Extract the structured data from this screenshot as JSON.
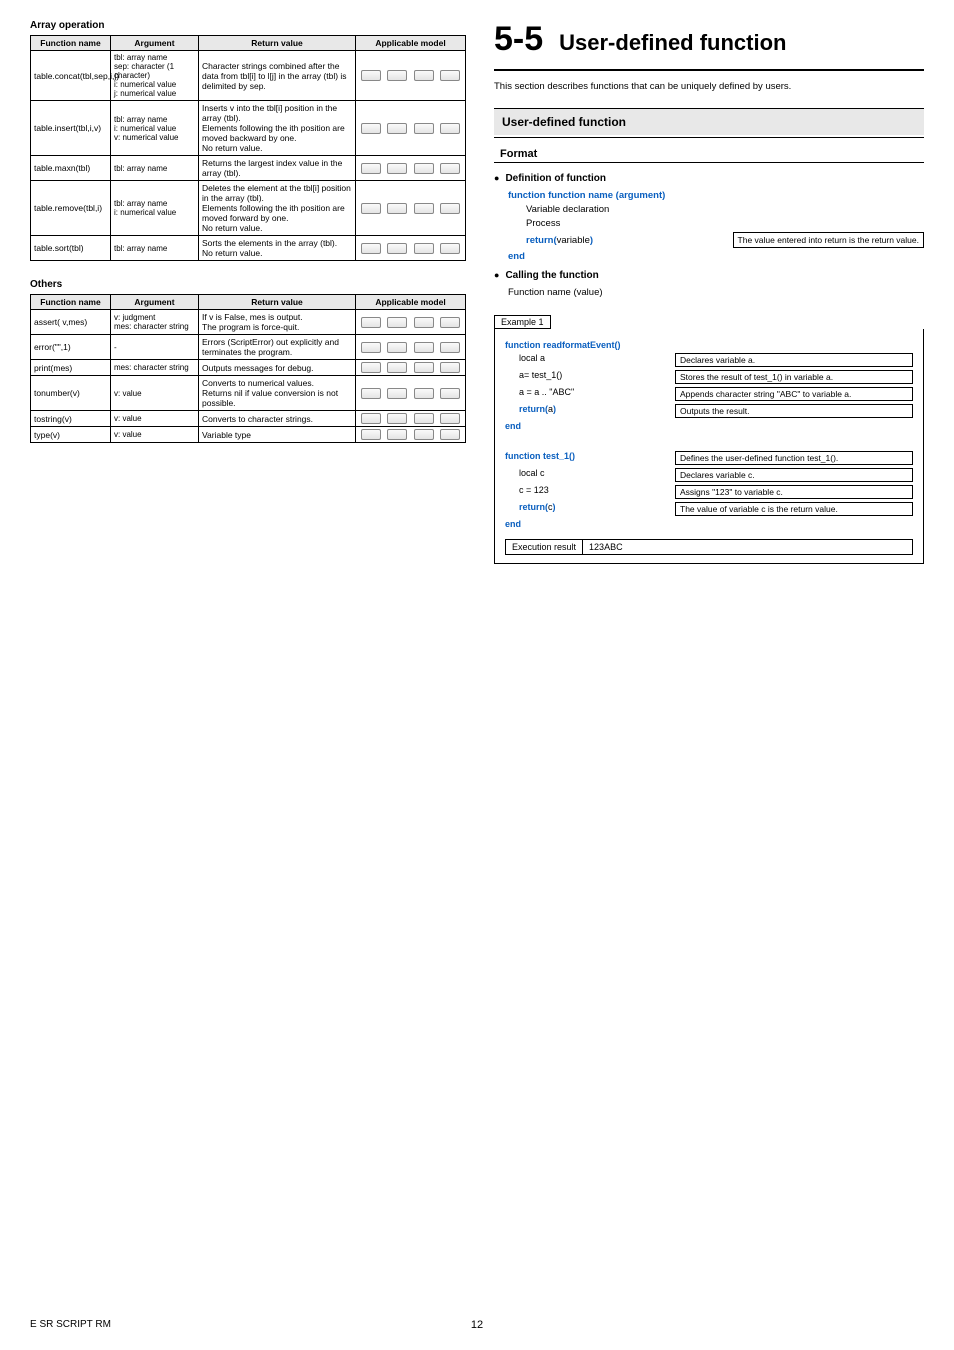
{
  "left": {
    "array_title": "Array operation",
    "headers": {
      "fn": "Function name",
      "arg": "Argument",
      "ret": "Return value",
      "app": "Applicable model"
    },
    "array_rows": [
      {
        "fn": "table.concat(tbl,sep,i,j)",
        "arg": "tbl: array name\nsep: character (1 character)\ni: numerical value\nj: numerical value",
        "ret": "Character strings combined after the data from tbl[i] to l[j] in the array (tbl) is delimited by sep."
      },
      {
        "fn": "table.insert(tbl,i,v)",
        "arg": "tbl: array name\ni: numerical value\nv: numerical value",
        "ret": "Inserts v into the tbl[i] position in the array (tbl).\nElements following the ith position are moved backward by one.\nNo return value."
      },
      {
        "fn": "table.maxn(tbl)",
        "arg": "tbl: array name",
        "ret": "Returns the largest index value in the array (tbl)."
      },
      {
        "fn": "table.remove(tbl,i)",
        "arg": "tbl: array name\ni: numerical value",
        "ret": "Deletes the element at the tbl[i] position in the array (tbl).\nElements following the ith position are moved forward by one.\nNo return value."
      },
      {
        "fn": "table.sort(tbl)",
        "arg": "tbl: array name",
        "ret": "Sorts the elements in the array (tbl).\nNo return value."
      }
    ],
    "others_title": "Others",
    "others_rows": [
      {
        "fn": "assert( v,mes)",
        "arg": "v: judgment\nmes: character string",
        "ret": "If v is False, mes is output.\nThe program is force-quit."
      },
      {
        "fn": "error(\"\",1)",
        "arg": "-",
        "ret": "Errors (ScriptError) out explicitly and terminates the program."
      },
      {
        "fn": "print(mes)",
        "arg": "mes: character string",
        "ret": "Outputs messages for debug."
      },
      {
        "fn": "tonumber(v)",
        "arg": "v: value",
        "ret": "Converts to numerical values.\nReturns nil if value conversion is not possible."
      },
      {
        "fn": "tostring(v)",
        "arg": "v: value",
        "ret": "Converts to character strings."
      },
      {
        "fn": "type(v)",
        "arg": "v: value",
        "ret": "Variable type"
      }
    ]
  },
  "right": {
    "chapter_num": "5-5",
    "chapter_title": "User-defined function",
    "intro": "This section describes functions that can be uniquely defined by users.",
    "subhead": "User-defined function",
    "format": "Format",
    "def_head": "Definition of function",
    "def_sig": "function function name (argument)",
    "def_var": "Variable declaration",
    "def_proc": "Process",
    "def_ret_kw": "return(",
    "def_ret_v": "variable",
    "def_ret_close": ")",
    "def_ret_note": "The value entered into return is the return value.",
    "def_end": "end",
    "call_head": "Calling the function",
    "call_line": "Function name (value)",
    "example_label": "Example 1",
    "ex1_fn": "function readformatEvent()",
    "ex1_rows": [
      {
        "code": "local a",
        "desc": "Declares variable a."
      },
      {
        "code": "a= test_1()",
        "desc": "Stores the result of test_1() in variable a."
      },
      {
        "code": "a = a .. \"ABC\"",
        "desc": "Appends character string \"ABC\" to variable a."
      },
      {
        "code_kw": "return(",
        "code_v": "a",
        "code_close": ")",
        "desc": "Outputs the result."
      }
    ],
    "ex1_end": "end",
    "ex2_fn": "function test_1()",
    "ex2_desc_fn": "Defines the user-defined function test_1().",
    "ex2_rows": [
      {
        "code": "local c",
        "desc": "Declares variable c."
      },
      {
        "code": "c = 123",
        "desc": "Assigns \"123\" to variable c."
      },
      {
        "code_kw": "return(",
        "code_v": "c",
        "code_close": ")",
        "desc": "The value of variable c is the return value."
      }
    ],
    "ex2_end": "end",
    "exec_label": "Execution result",
    "exec_value": "123ABC"
  },
  "footer": {
    "left": "E SR SCRIPT RM",
    "page": "12"
  }
}
